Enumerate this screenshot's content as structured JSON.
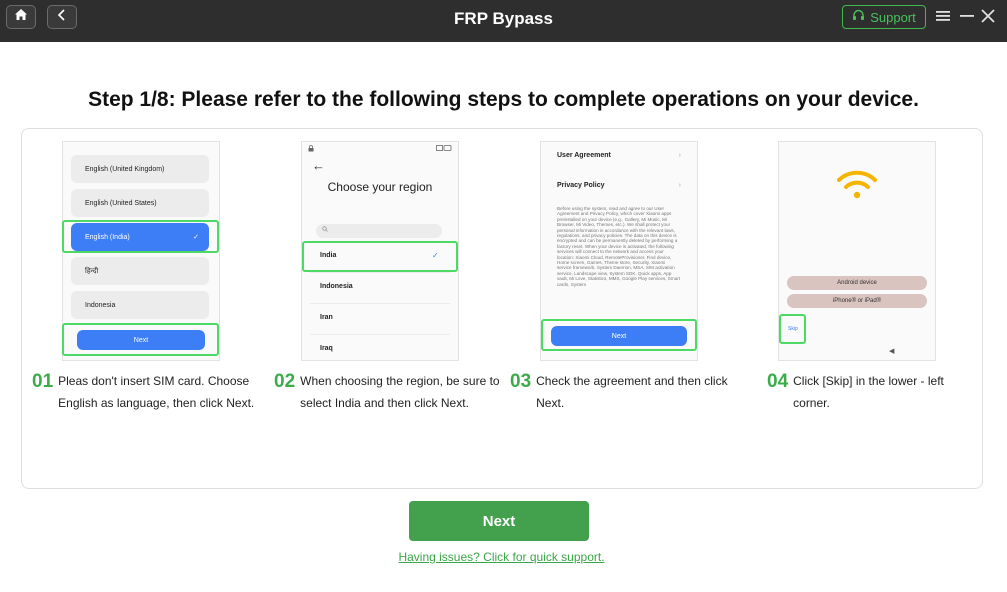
{
  "app": {
    "title": "FRP Bypass",
    "support_label": "Support"
  },
  "step_title": "Step 1/8: Please refer to the following steps to complete operations on your device.",
  "phone1": {
    "languages": [
      "English (United Kingdom)",
      "English (United States)",
      "English (India)",
      "हिन्दी",
      "Indonesia"
    ],
    "check": "✓",
    "next_label": "Next"
  },
  "phone2": {
    "title": "Choose your region",
    "regions": [
      "India",
      "Indonesia",
      "Iran",
      "Iraq"
    ],
    "check": "✓"
  },
  "phone3": {
    "row1": "User Agreement",
    "row2": "Privacy Policy",
    "body": "Before using the system, read and agree to our User Agreement and Privacy Policy, which cover Xiaomi apps preinstalled on your device (e.g., Gallery, Mi Music, Mi Browser, Mi Video, Themes, etc.). We shall protect your personal information in accordance with the relevant laws, regulations, and privacy policies. The data on this device is encrypted and can be permanently deleted by performing a factory reset. When your device is activated, the following services will connect to the network and access your location: Xiaomi Cloud, RemoteProvisioner, Find device, Home screen, Games, Theme store, Security, Xiaomi service framework, System Daemon, MSA, SIM activation service, Landscape view, System SDK, Quick apps, App vault, Mi Love, Statistics, MMS, Google Play services, Smart cards, System",
    "next_label": "Next"
  },
  "phone4": {
    "android_label": "Android device",
    "iphone_label": "iPhone® or iPad®",
    "skip_label": "Skip"
  },
  "steps": [
    {
      "num": "01",
      "text": "Pleas don't insert SIM card. Choose English as language, then click Next."
    },
    {
      "num": "02",
      "text": "When choosing the region, be sure to select India and then click Next."
    },
    {
      "num": "03",
      "text": "Check the agreement and then click Next."
    },
    {
      "num": "04",
      "text": "Click [Skip] in the lower - left corner."
    }
  ],
  "main_next_label": "Next",
  "help_link": "Having issues? Click for quick support.",
  "colors": {
    "accent_green": "#43a04d",
    "highlight_green": "#4cd964",
    "phone_blue": "#3d7ef6",
    "titlebar": "#2e2e2e"
  }
}
